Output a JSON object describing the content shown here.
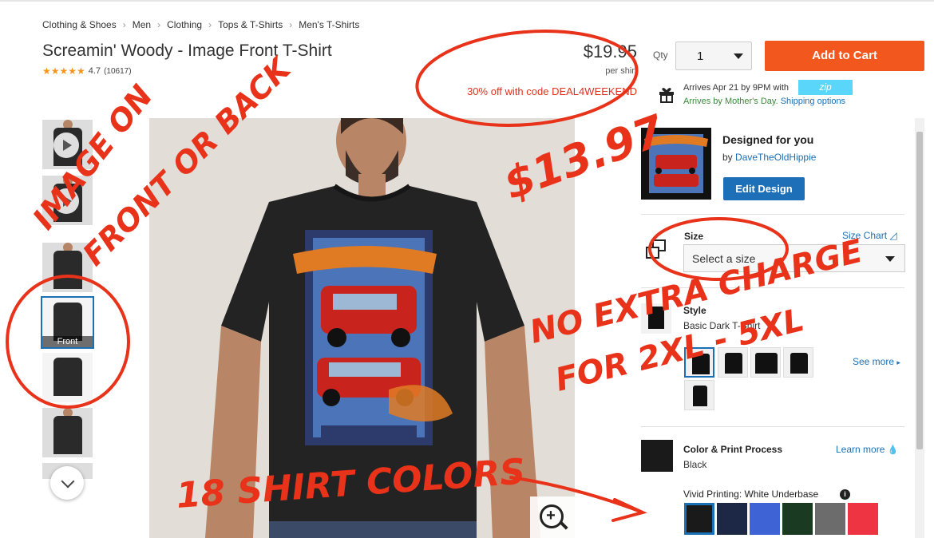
{
  "breadcrumbs": [
    "Clothing & Shoes",
    "Men",
    "Clothing",
    "Tops & T-Shirts",
    "Men's T-Shirts"
  ],
  "product": {
    "title": "Screamin' Woody - Image Front T-Shirt",
    "rating": "4.7",
    "reviews": "(10617)",
    "price": "$19.95",
    "price_unit": "per shirt",
    "promo": "30% off with code DEAL4WEEKEND"
  },
  "purchase": {
    "qty_label": "Qty",
    "qty_value": "1",
    "add_to_cart": "Add to Cart",
    "arrives": "Arrives Apr 21 by 9PM with",
    "zip_logo": "zip",
    "mothers_day": "Arrives by Mother's Day.",
    "shipping_options": "Shipping options"
  },
  "thumbnails": {
    "front_caption": "Front"
  },
  "design": {
    "title": "Designed for you",
    "by": "by",
    "designer": "DaveTheOldHippie",
    "edit_button": "Edit Design"
  },
  "size": {
    "label": "Size",
    "chart_link": "Size Chart",
    "placeholder": "Select a size"
  },
  "style": {
    "label": "Style",
    "name": "Basic Dark T-Shirt",
    "see_more": "See more"
  },
  "color": {
    "title": "Color & Print Process",
    "name": "Black",
    "learn_more": "Learn more",
    "vivid": "Vivid Printing: White Underbase",
    "swatches": [
      "#1a1a1a",
      "#1c2846",
      "#3e63d4",
      "#1a3b22",
      "#6c6c6c",
      "#ee3342"
    ]
  },
  "annotations": {
    "image_front_back": [
      "IMAGE ON",
      "FRONT OR BACK"
    ],
    "sale_price": "$13.97",
    "no_extra_charge": [
      "NO EXTRA CHARGE",
      "FOR 2XL - 5XL"
    ],
    "shirt_colors": "18 SHIRT COLORS",
    "ink_color": "#e8321a"
  }
}
